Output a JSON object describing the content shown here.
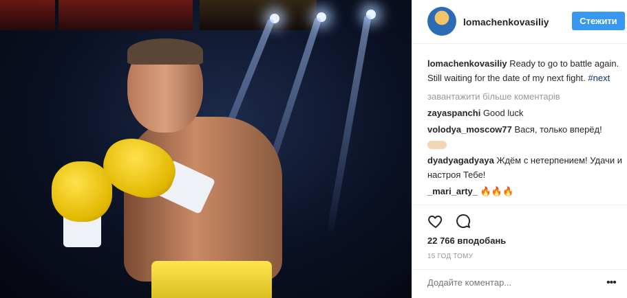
{
  "post": {
    "image_icon": "boxer-photo",
    "author": "lomachenkovasiliy",
    "follow_label": "Стежити"
  },
  "caption": {
    "user": "lomachenkovasiliy",
    "text": " Ready to go to battle again. Still waiting for the date of my next fight. ",
    "hashtag": "#next"
  },
  "load_more": "завантажити більше коментарів",
  "comments": [
    {
      "user": "zayaspanchi",
      "text": " Good luck"
    },
    {
      "user": "volodya_moscow77",
      "text": " Вася, только вперёд!"
    },
    {
      "user": "dyadyagadyaya",
      "text": " Ждём с нетерпением! Удачи и настроя Тебе!"
    },
    {
      "user": "_mari_arty_",
      "text": " 🔥🔥🔥"
    }
  ],
  "likes": "22 766 вподобань",
  "time": "15 ГОД ТОМУ",
  "add_comment": {
    "placeholder": "Додайте коментар..."
  },
  "icons": {
    "like": "heart-icon",
    "comment": "comment-icon",
    "more": "more-icon"
  },
  "colors": {
    "accent": "#3897f0",
    "text": "#262626",
    "muted": "#999999"
  }
}
